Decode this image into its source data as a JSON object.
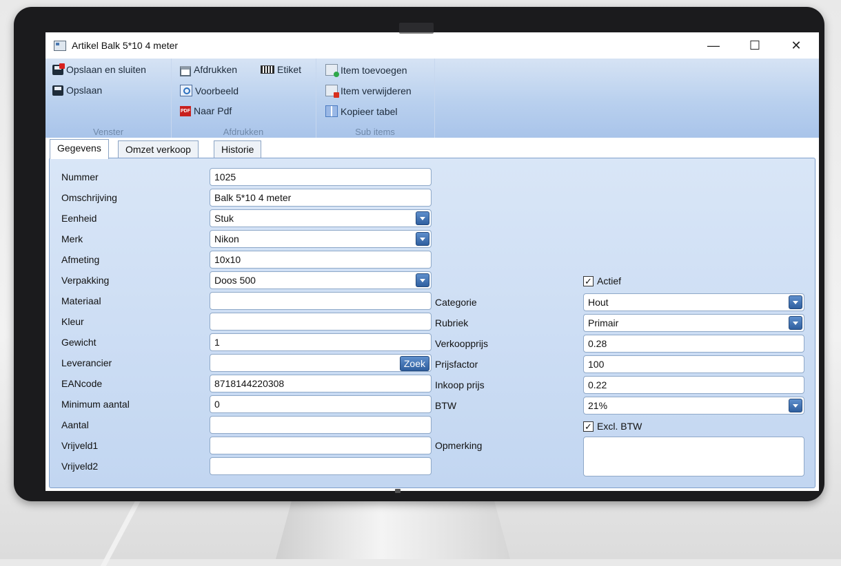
{
  "window": {
    "title": "Artikel Balk 5*10 4 meter",
    "minimize": "—",
    "maximize": "☐",
    "close": "✕"
  },
  "ribbon": {
    "groups": [
      {
        "label": "Venster",
        "items": [
          "Opslaan en sluiten",
          "Opslaan"
        ]
      },
      {
        "label": "Afdrukken",
        "items": [
          "Afdrukken",
          "Etiket",
          "Voorbeeld",
          "Naar Pdf"
        ]
      },
      {
        "label": "Sub items",
        "items": [
          "Item toevoegen",
          "Item verwijderen",
          "Kopieer tabel"
        ]
      }
    ]
  },
  "tabs": [
    "Gegevens",
    "Omzet verkoop",
    "Historie"
  ],
  "form": {
    "left": [
      {
        "label": "Nummer",
        "value": "1025",
        "type": "text"
      },
      {
        "label": "Omschrijving",
        "value": "Balk 5*10 4 meter",
        "type": "text"
      },
      {
        "label": "Eenheid",
        "value": "Stuk",
        "type": "select"
      },
      {
        "label": "Merk",
        "value": "Nikon",
        "type": "select"
      },
      {
        "label": "Afmeting",
        "value": "10x10",
        "type": "text"
      },
      {
        "label": "Verpakking",
        "value": "Doos 500",
        "type": "select"
      },
      {
        "label": "Materiaal",
        "value": "",
        "type": "text"
      },
      {
        "label": "Kleur",
        "value": "",
        "type": "text"
      },
      {
        "label": "Gewicht",
        "value": "1",
        "type": "text"
      },
      {
        "label": "Leverancier",
        "value": "",
        "type": "search",
        "button": "Zoek"
      },
      {
        "label": "EANcode",
        "value": "8718144220308",
        "type": "text"
      },
      {
        "label": "Minimum aantal",
        "value": "0",
        "type": "text"
      },
      {
        "label": "Aantal",
        "value": "",
        "type": "text"
      },
      {
        "label": "Vrijveld1",
        "value": "",
        "type": "text"
      },
      {
        "label": "Vrijveld2",
        "value": "",
        "type": "text"
      }
    ],
    "actief": {
      "label": "Actief",
      "checked": true
    },
    "right": [
      {
        "label": "Categorie",
        "value": "Hout",
        "type": "select"
      },
      {
        "label": "Rubriek",
        "value": "Primair",
        "type": "select"
      },
      {
        "label": "Verkoopprijs",
        "value": "0.28",
        "type": "text"
      },
      {
        "label": "Prijsfactor",
        "value": "100",
        "type": "text"
      },
      {
        "label": "Inkoop prijs",
        "value": "0.22",
        "type": "text"
      },
      {
        "label": "BTW",
        "value": "21%",
        "type": "select"
      }
    ],
    "excl_btw": {
      "label": "Excl. BTW",
      "checked": true
    },
    "opmerking": {
      "label": "Opmerking",
      "value": ""
    }
  }
}
